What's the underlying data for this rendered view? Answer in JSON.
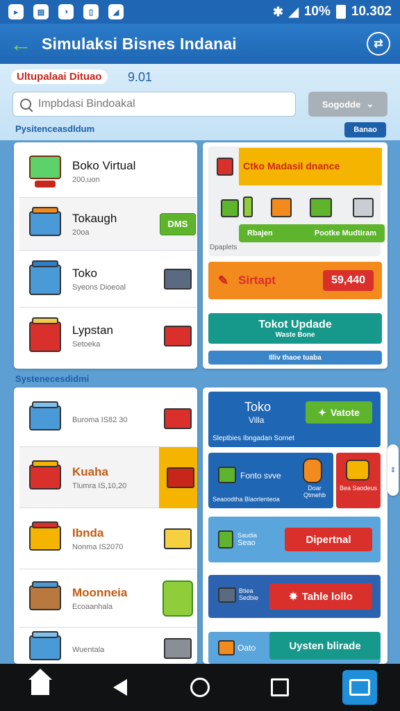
{
  "status": {
    "time": "10.302",
    "battery": "10%",
    "icons": [
      "notification-icon",
      "message-icon",
      "app-icon",
      "file-icon",
      "image-icon"
    ]
  },
  "appbar": {
    "title": "Simulaksi Bisnes Indanai"
  },
  "top": {
    "tag_label": "Ultupalaai Dituao",
    "tag_value": "9.01",
    "search_placeholder": "Impbdasi Bindoakal",
    "dropdown_label": "Sogodde",
    "section1_label": "Pysitenceasdldum",
    "section_button": "Banao",
    "section2_label": "Systenecesdidmi"
  },
  "list1": [
    {
      "title": "Boko Virtual",
      "sub": "200,uon",
      "side": "none"
    },
    {
      "title": "Tokaugh",
      "sub": "20oa",
      "side": "DMS"
    },
    {
      "title": "Toko",
      "sub": "Syeons Dioeoal",
      "side": "box"
    },
    {
      "title": "Lypstan",
      "sub": "Setoeka",
      "side": "box"
    }
  ],
  "right1": {
    "banner_title": "Ctko Madasil dnance",
    "banner_btn_left": "Rbajen",
    "banner_btn_right": "Pootke Mudtiram",
    "banner_caption": "Dpaplets",
    "start_label": "Sirtapt",
    "start_value": "59,440",
    "update_title": "Tokot Updade",
    "update_sub": "Waste Bone",
    "strip_text": "Illiv thaoe tuaba"
  },
  "list2": [
    {
      "title": "",
      "sub": "Buroma IS82 30",
      "highlight": false
    },
    {
      "title": "Kuaha",
      "sub": "Tlumra IS,10,20",
      "highlight": true
    },
    {
      "title": "Ibnda",
      "sub": "Nonma IS2070",
      "highlight": false
    },
    {
      "title": "Moonneia",
      "sub": "Ecoaanhala",
      "highlight": false
    },
    {
      "title": "",
      "sub": "Wuentala",
      "highlight": false
    }
  ],
  "right2": {
    "toko_title": "Toko",
    "toko_sub": "Villa",
    "toko_btn": "Vatote",
    "toko_caption": "Sleptbies Ibngadan Sornet",
    "card2_label": "Fonto svve",
    "card2_caption": "Seaoodtha Blaorlenteoa",
    "card2_icon_label": "Doar Qtmehb",
    "card3_label": "Bea Saodeus",
    "card4_small": "Saudia",
    "card4_label": "Seao",
    "card4_btn": "Dipertnal",
    "card5_small": "Btiea Sedbie",
    "card5_btn": "Tahle lollo",
    "card6_label": "Oato",
    "card6_btn": "Uysten blirade"
  },
  "colors": {
    "primary": "#1f67b5",
    "accent_green": "#5fb42d",
    "accent_orange": "#f28a1e",
    "accent_red": "#d9302c",
    "teal": "#16988a"
  }
}
